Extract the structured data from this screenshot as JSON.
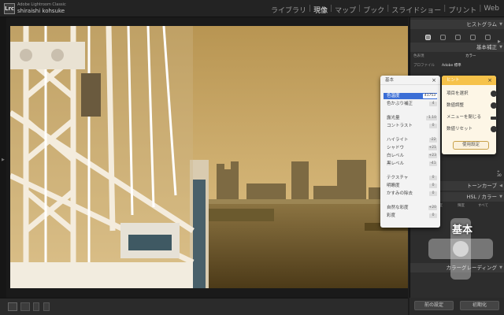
{
  "app": {
    "logo_text": "Lrc",
    "name": "Adobe Lightroom Classic",
    "user": "shiraishi kohsuke"
  },
  "modules": [
    "ライブラリ",
    "現像",
    "マップ",
    "ブック",
    "スライドショー",
    "プリント",
    "Web"
  ],
  "active_module": "現像",
  "right_panel": {
    "histogram_label": "ヒストグラム",
    "basic_label": "基本補正",
    "treatment_label": "色表現",
    "treatment_value": "カラー",
    "profile_label": "プロファイル",
    "profile_value": "Adobe 標準",
    "tone_curve_label": "トーンカーブ",
    "hsl_label": "HSL / カラー",
    "hsl_tabs": [
      "色相",
      "彩度",
      "輝度",
      "すべて"
    ],
    "color_grading_label": "カラーグレーディング",
    "slider_value": "+ 30"
  },
  "bottom_buttons": {
    "previous": "前の設定",
    "reset": "初期化"
  },
  "basic_popup": {
    "title": "基本",
    "rows": [
      {
        "label": "色温度",
        "value": "41753",
        "selected": true
      },
      {
        "label": "色かぶり補正",
        "value": "4"
      },
      {
        "label": "露光量",
        "value": "-1.10"
      },
      {
        "label": "コントラスト",
        "value": "0"
      },
      {
        "label": "ハイライト",
        "value": "-22"
      },
      {
        "label": "シャドウ",
        "value": "+21"
      },
      {
        "label": "白レベル",
        "value": "+23"
      },
      {
        "label": "黒レベル",
        "value": "-41"
      },
      {
        "label": "テクスチャ",
        "value": "0"
      },
      {
        "label": "明瞭度",
        "value": "0"
      },
      {
        "label": "かすみの除去",
        "value": "0"
      },
      {
        "label": "自然な彩度",
        "value": "+20"
      },
      {
        "label": "彩度",
        "value": "0"
      }
    ]
  },
  "hint_popup": {
    "title": "ヒント",
    "rows": [
      "項目を選択",
      "数値調整",
      "メニューを閉じる",
      "数値リセット"
    ],
    "button": "使用設定"
  },
  "loupe": {
    "label": "基本"
  },
  "colors": {
    "accent_blue": "#3b6ed6",
    "hint_yellow": "#f6c24a",
    "sky": "#d9b56c",
    "water": "#5f4a22"
  }
}
